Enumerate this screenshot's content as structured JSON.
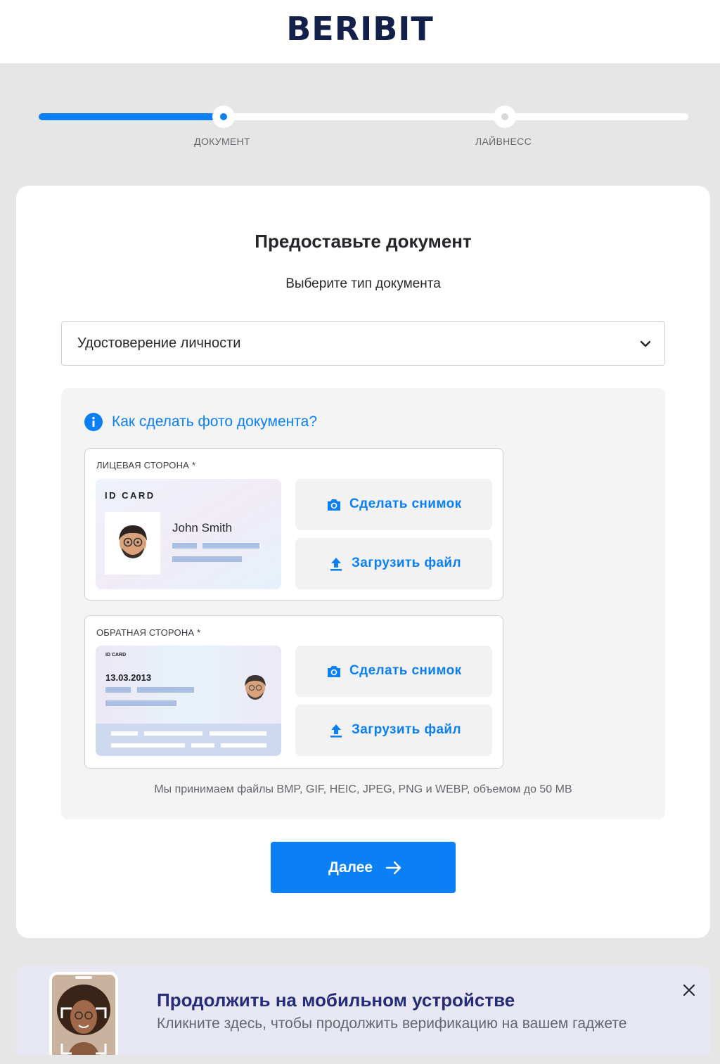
{
  "header": {
    "logo": "BERIBIT"
  },
  "stepper": {
    "steps": [
      {
        "label": "ДОКУМЕНТ",
        "state": "active"
      },
      {
        "label": "ЛАЙВНЕСС",
        "state": "pending"
      }
    ],
    "progress_fraction": 0.28
  },
  "card": {
    "title": "Предоставьте документ",
    "subtitle": "Выберите тип документа",
    "document_type": {
      "selected": "Удостоверение личности"
    },
    "help_link": "Как сделать фото документа?",
    "front": {
      "label": "ЛИЦЕВАЯ СТОРОНА *",
      "sample": {
        "header": "ID CARD",
        "name": "John Smith"
      },
      "take_photo_label": "Сделать снимок",
      "upload_label": "Загрузить файл"
    },
    "back": {
      "label": "ОБРАТНАЯ СТОРОНА *",
      "sample": {
        "header": "ID CARD",
        "date": "13.03.2013"
      },
      "take_photo_label": "Сделать снимок",
      "upload_label": "Загрузить файл"
    },
    "formats_note": "Мы принимаем файлы BMP, GIF, HEIC, JPEG, PNG и WEBP, объемом до 50 MB",
    "next_label": "Далее"
  },
  "mobile_banner": {
    "title": "Продолжить на мобильном устройстве",
    "subtitle": "Кликните здесь, чтобы продолжить верификацию на вашем гаджете"
  },
  "colors": {
    "accent": "#0b80f4",
    "background": "#e6e6e7",
    "logo": "#13214a",
    "banner_title": "#262b7a"
  },
  "icons": [
    "info-icon",
    "chevron-down-icon",
    "camera-icon",
    "upload-icon",
    "arrow-right-icon",
    "close-icon"
  ]
}
